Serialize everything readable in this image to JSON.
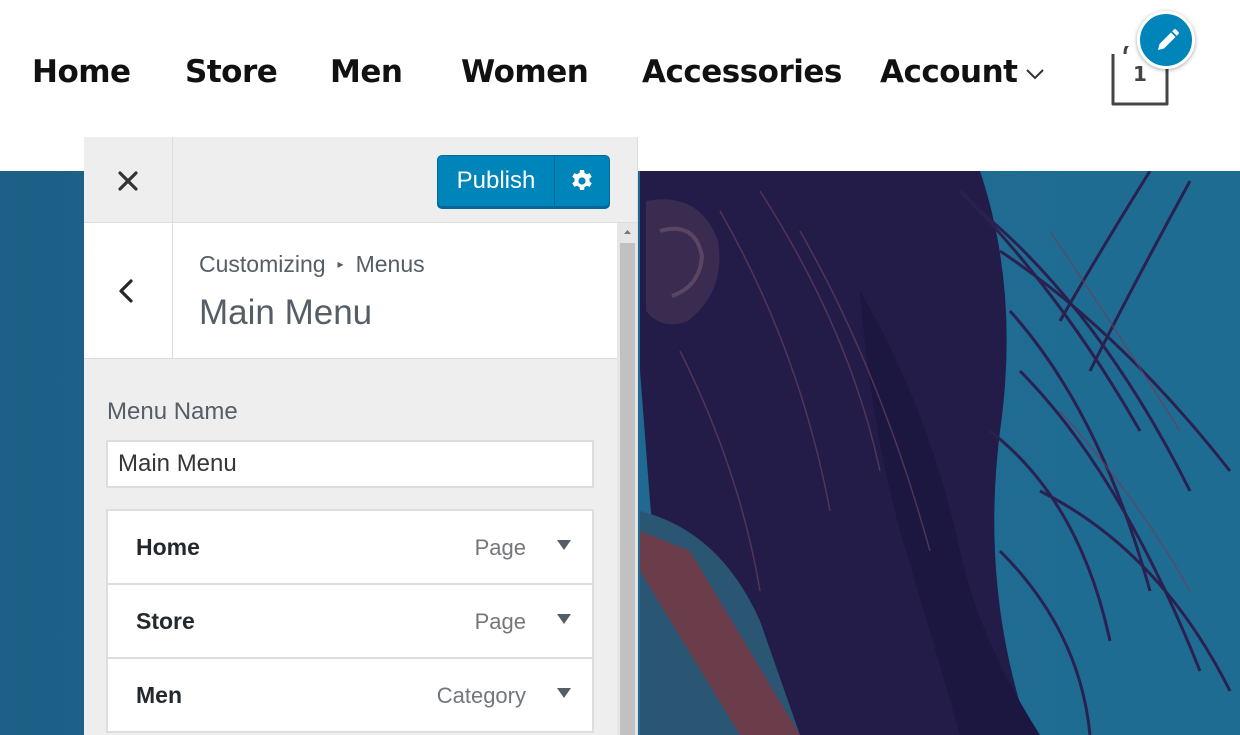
{
  "site_nav": {
    "items": [
      "Home",
      "Store",
      "Men",
      "Women",
      "Accessories",
      "Account"
    ],
    "cart_count": "1"
  },
  "icons": {
    "close": "close-icon",
    "settings": "gear-icon",
    "back": "chevron-left-icon",
    "edit": "pencil-icon",
    "cart": "cart-icon",
    "dropdown": "chevron-down-icon",
    "toggle": "triangle-down-icon"
  },
  "colors": {
    "accent": "#0085ba",
    "hero": "#1f6a91",
    "panel_bg": "#eeeeee"
  },
  "customizer": {
    "publish_label": "Publish",
    "breadcrumb": {
      "root": "Customizing",
      "section": "Menus"
    },
    "title": "Main Menu",
    "menu_name_label": "Menu Name",
    "menu_name_value": "Main Menu",
    "menu_items": [
      {
        "title": "Home",
        "type": "Page"
      },
      {
        "title": "Store",
        "type": "Page"
      },
      {
        "title": "Men",
        "type": "Category"
      }
    ]
  }
}
